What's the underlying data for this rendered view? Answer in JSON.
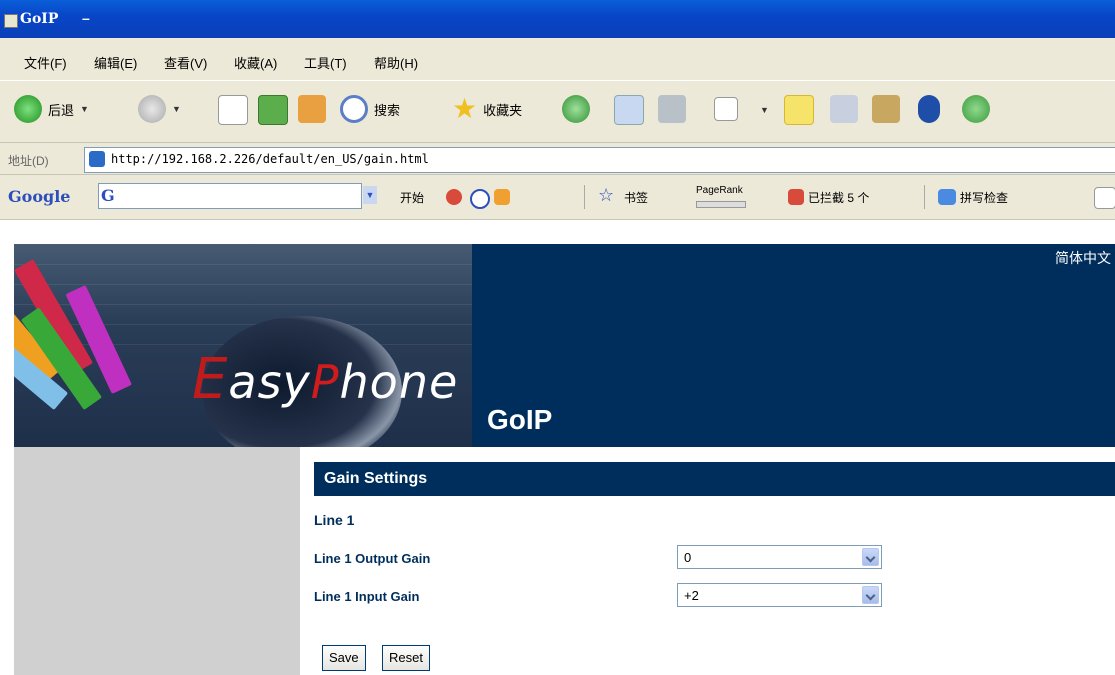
{
  "window": {
    "title": "GoIP",
    "title_suffix": "–"
  },
  "menu": {
    "items": [
      "文件(F)",
      "编辑(E)",
      "查看(V)",
      "收藏(A)",
      "工具(T)",
      "帮助(H)"
    ]
  },
  "toolbar": {
    "back_label": "后退",
    "search_label": "搜索",
    "favorites_label": "收藏夹"
  },
  "address": {
    "label": "地址(D)",
    "url": "http://192.168.2.226/default/en_US/gain.html"
  },
  "google": {
    "logo": "Google",
    "g_letter": "G",
    "start_label": "开始",
    "bookmarks_label": "书签",
    "pagerank_label": "PageRank",
    "blocked_label": "已拦截 5 个",
    "spellcheck_label": "拼写检查"
  },
  "banner": {
    "lang_link": "简体中文",
    "product": "GoIP",
    "logo_text": "EasyPhone"
  },
  "gain": {
    "header": "Gain Settings",
    "section": "Line 1",
    "output_label": "Line 1 Output Gain",
    "output_value": "0",
    "input_label": "Line 1 Input Gain",
    "input_value": "+2",
    "save_label": "Save",
    "reset_label": "Reset"
  },
  "colors": {
    "header_bg": "#002e5c",
    "label_color": "#002e5c",
    "sidebar_bg": "#d0d0d0"
  }
}
